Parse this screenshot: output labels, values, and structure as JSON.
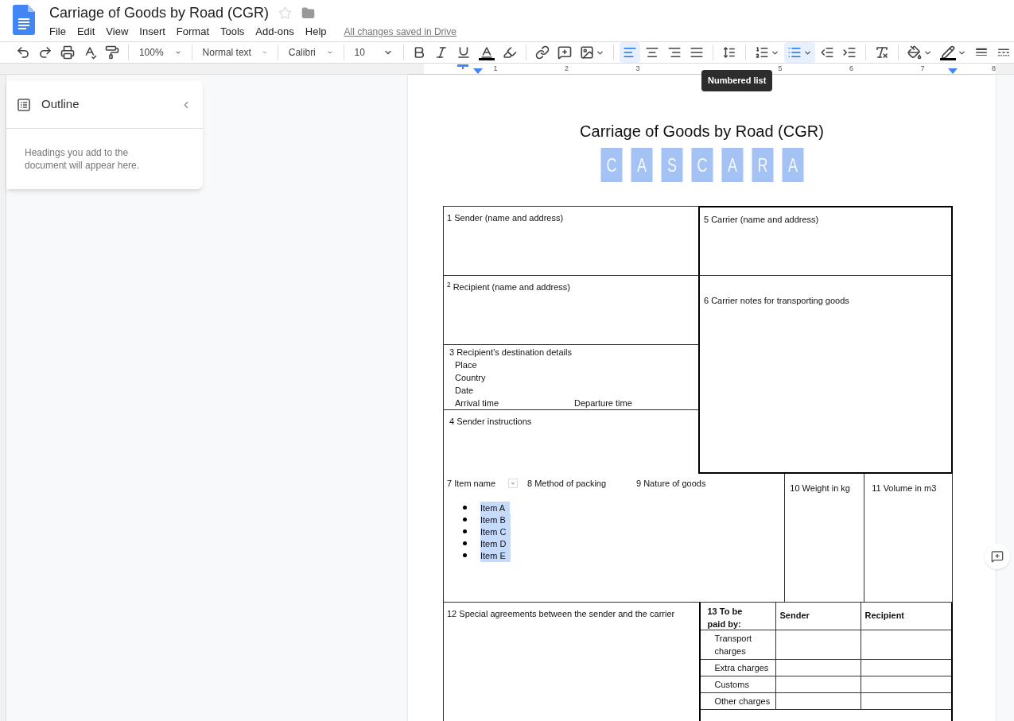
{
  "document": {
    "title": "Carriage of Goods by Road (CGR)",
    "starred": false,
    "save_status": "All changes saved in Drive"
  },
  "menu": [
    "File",
    "Edit",
    "View",
    "Insert",
    "Format",
    "Tools",
    "Add-ons",
    "Help"
  ],
  "toolbar": [
    {
      "kind": "icon",
      "selected": false
    },
    {
      "kind": "icon",
      "selected": false
    },
    {
      "kind": "icon",
      "selected": false
    },
    {
      "kind": "icon",
      "selected": false
    },
    {
      "kind": "icon",
      "selected": false
    },
    {
      "kind": "separator"
    },
    {
      "kind": "dropdown",
      "value": "100%"
    },
    {
      "kind": "separator"
    },
    {
      "kind": "dropdown",
      "value": "Normal text"
    },
    {
      "kind": "separator"
    },
    {
      "kind": "dropdown",
      "value": "Calibri"
    },
    {
      "kind": "separator"
    },
    {
      "kind": "dropdown",
      "value": "10"
    },
    {
      "kind": "separator"
    },
    {
      "kind": "icon",
      "selected": false
    },
    {
      "kind": "icon",
      "selected": false
    },
    {
      "kind": "icon",
      "selected": false
    },
    {
      "kind": "icon",
      "selected": false
    },
    {
      "kind": "icon",
      "selected": false
    },
    {
      "kind": "separator"
    },
    {
      "kind": "icon",
      "selected": false
    },
    {
      "kind": "icon",
      "selected": false
    },
    {
      "kind": "icon_menu",
      "selected": false
    },
    {
      "kind": "separator"
    },
    {
      "kind": "icon",
      "selected": true
    },
    {
      "kind": "icon",
      "selected": false
    },
    {
      "kind": "icon",
      "selected": false
    },
    {
      "kind": "icon",
      "selected": false
    },
    {
      "kind": "separator"
    },
    {
      "kind": "icon",
      "selected": false
    },
    {
      "kind": "separator"
    },
    {
      "kind": "icon_menu",
      "selected": false
    },
    {
      "kind": "icon_menu",
      "selected": true
    },
    {
      "kind": "icon",
      "selected": false
    },
    {
      "kind": "icon",
      "selected": false
    },
    {
      "kind": "separator"
    },
    {
      "kind": "icon",
      "selected": false
    },
    {
      "kind": "separator"
    },
    {
      "kind": "icon_menu",
      "selected": false
    },
    {
      "kind": "icon_menu",
      "selected": false
    },
    {
      "kind": "icon",
      "selected": false
    },
    {
      "kind": "icon",
      "selected": false
    }
  ],
  "tooltip": "Numbered list",
  "ruler": {
    "left_numbers": [
      "1",
      "2",
      "3"
    ],
    "right_numbers": [
      "5",
      "6",
      "7",
      "8"
    ]
  },
  "outline": {
    "title": "Outline",
    "message": "Headings you add to the document will appear here."
  },
  "page": {
    "heading": "Carriage of Goods by Road (CGR)",
    "logo_letters": [
      "C",
      "A",
      "S",
      "C",
      "A",
      "R",
      "A"
    ],
    "sender": "1 Sender (name and address)",
    "recipient": "$^{2}$ Recipient (name and address)",
    "destination": {
      "title": "3 Recipient’s destination details",
      "place": "Place",
      "country": "Country",
      "date": "Date",
      "arrival": "Arrival time",
      "departure": "Departure time"
    },
    "instructions": "4 Sender instructions",
    "carrier": "5 Carrier (name and address)",
    "carrier_notes": "6 Carrier notes for transporting goods",
    "goods": {
      "item_name": "7 Item name",
      "packing": "8 Method of packing",
      "nature": "9 Nature of goods",
      "weight": "10 Weight in kg",
      "volume": "11 Volume in m3",
      "items": [
        {
          "text": "Item A",
          "selected": true
        },
        {
          "text": "Item B",
          "selected": true
        },
        {
          "text": "Item C",
          "selected": true
        },
        {
          "text": "Item D",
          "selected": true
        },
        {
          "text": "Item E",
          "selected": true
        }
      ]
    },
    "agreements": "12 Special agreements between the sender and the carrier",
    "payment": {
      "columns": [
        "13 To be paid by:",
        "Sender",
        "Recipient"
      ],
      "rows": [
        "Transport charges",
        "Extra charges",
        "Customs",
        "Other charges"
      ]
    }
  }
}
